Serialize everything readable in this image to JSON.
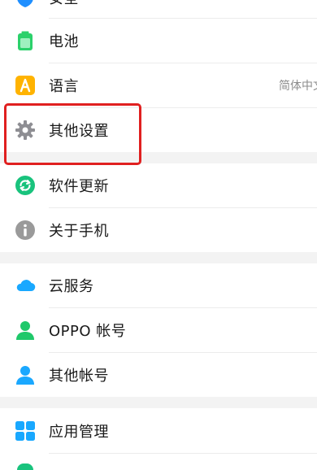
{
  "settings": {
    "items": [
      {
        "label": "安全",
        "icon": "shield-icon"
      },
      {
        "label": "电池",
        "icon": "battery-icon"
      },
      {
        "label": "语言",
        "icon": "language-icon",
        "value": "简体中文"
      },
      {
        "label": "其他设置",
        "icon": "gear-icon"
      },
      {
        "label": "软件更新",
        "icon": "refresh-icon"
      },
      {
        "label": "关于手机",
        "icon": "info-icon"
      },
      {
        "label": "云服务",
        "icon": "cloud-icon"
      },
      {
        "label": "OPPO 帐号",
        "icon": "user-icon"
      },
      {
        "label": "其他帐号",
        "icon": "user-icon"
      },
      {
        "label": "应用管理",
        "icon": "app-grid-icon"
      }
    ]
  },
  "colors": {
    "highlight": "#e02020",
    "shield": "#1f8fff",
    "battery": "#2bd16b",
    "language": "#ffb300",
    "gear": "#8e8e93",
    "update": "#19c37d",
    "info": "#9a9a9a",
    "cloud": "#19a8ff",
    "oppo_user": "#1fc86a",
    "other_user": "#1aa8ff",
    "apps": "#19a8ff",
    "section_gap": "#f3f3f3"
  }
}
